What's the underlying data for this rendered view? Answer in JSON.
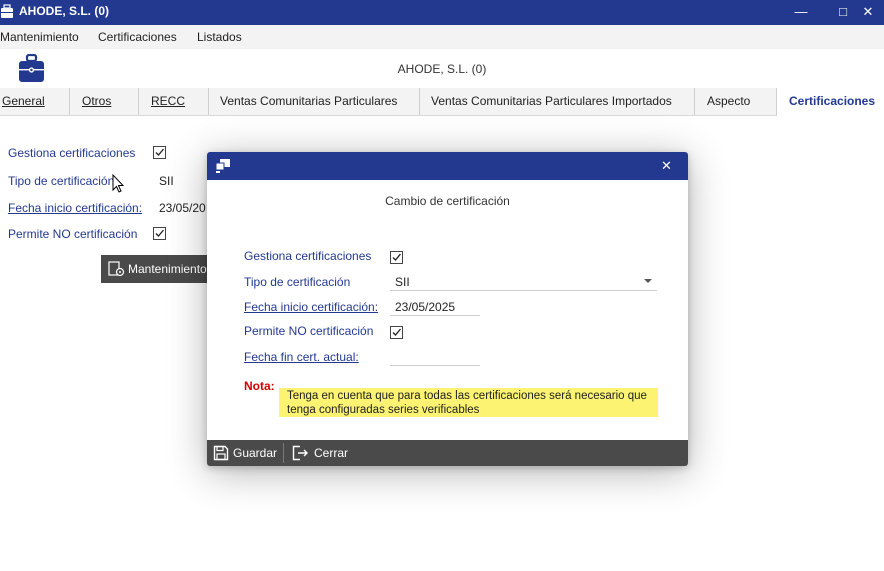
{
  "window": {
    "title": "AHODE, S.L. (0)",
    "minimize_glyph": "—",
    "maximize_glyph": "□",
    "close_glyph": "✕"
  },
  "menu": [
    "Mantenimiento",
    "Certificaciones",
    "Listados"
  ],
  "header": {
    "company": "AHODE, S.L. (0)",
    "icon": "briefcase-icon"
  },
  "tabs": [
    {
      "label": "General"
    },
    {
      "label": "Otros"
    },
    {
      "label": "RECC"
    },
    {
      "label": "Ventas Comunitarias Particulares"
    },
    {
      "label": "Ventas Comunitarias Particulares Importados"
    },
    {
      "label": "Aspecto"
    },
    {
      "label": "Certificaciones",
      "active": true
    }
  ],
  "background_form": {
    "gestiona_label": "Gestiona certificaciones",
    "gestiona_checked": true,
    "tipo_label": "Tipo de certificación",
    "tipo_value": "SII",
    "fecha_label": "Fecha inicio certificación:",
    "fecha_value": "23/05/20",
    "permite_label": "Permite NO certificación",
    "permite_checked": true,
    "mantenimiento_button": "Mantenimiento"
  },
  "dialog": {
    "heading": "Cambio de certificación",
    "close_glyph": "✕",
    "gestiona_label": "Gestiona certificaciones",
    "gestiona_checked": true,
    "tipo_label": "Tipo de certificación",
    "tipo_value": "SII",
    "fecha_inicio_label": "Fecha inicio certificación:",
    "fecha_inicio_value": "23/05/2025",
    "permite_label": "Permite NO certificación",
    "permite_checked": true,
    "fecha_fin_label": "Fecha fin cert. actual:",
    "fecha_fin_value": "",
    "nota_label": "Nota:",
    "nota_text_1": "Tenga en cuenta que para todas las certificaciones será necesario que",
    "nota_text_2": "tenga configuradas series verificables",
    "guardar_label": "Guardar",
    "cerrar_label": "Cerrar"
  },
  "colors": {
    "titlebar": "#23398f",
    "footer": "#4a4a4a",
    "note_bg": "#fbf371",
    "nota_red": "#d40000",
    "label_blue": "#23398f"
  }
}
